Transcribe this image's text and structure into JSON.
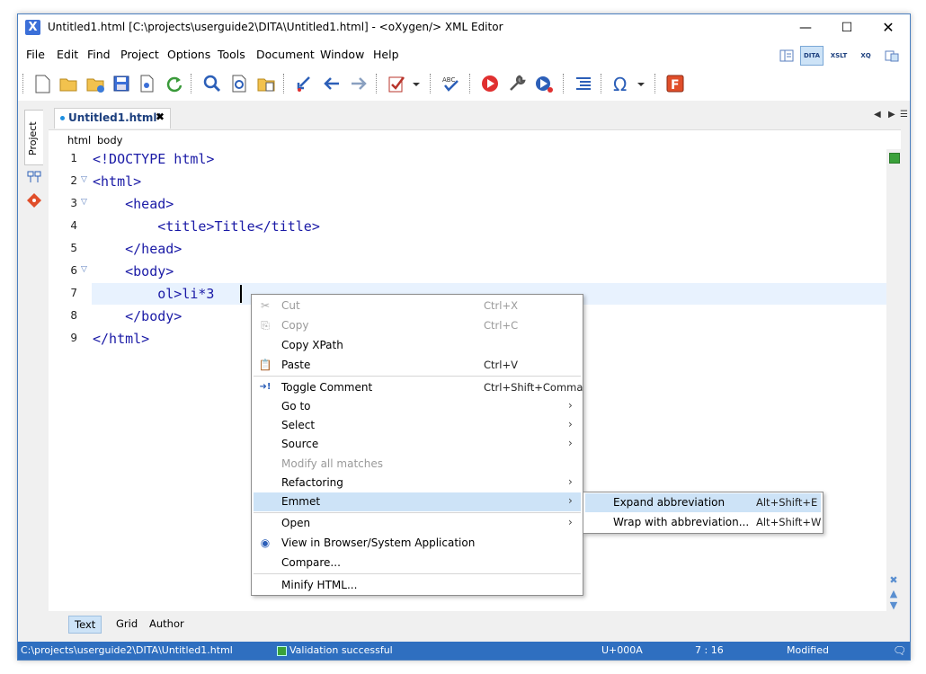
{
  "window": {
    "title": "Untitled1.html [C:\\projects\\userguide2\\DITA\\Untitled1.html] - <oXygen/> XML Editor",
    "minimize": "—",
    "maximize": "☐",
    "close": "✕"
  },
  "menubar": [
    "File",
    "Edit",
    "Find",
    "Project",
    "Options",
    "Tools",
    "Document",
    "Window",
    "Help"
  ],
  "perspectives": [
    "",
    "DITA",
    "XSLT",
    "XQ",
    ""
  ],
  "sidebar": {
    "project_tab": "Project"
  },
  "tab": {
    "name": "Untitled1.html*",
    "close": "✖"
  },
  "breadcrumb": [
    "html",
    "body"
  ],
  "code": {
    "lines": [
      {
        "no": "1",
        "text": "<!DOCTYPE html>"
      },
      {
        "no": "2",
        "text": "<html>"
      },
      {
        "no": "3",
        "text": "    <head>"
      },
      {
        "no": "4",
        "text": "        <title>Title</title>"
      },
      {
        "no": "5",
        "text": "    </head>"
      },
      {
        "no": "6",
        "text": "    <body>"
      },
      {
        "no": "7",
        "text": "        ol>li*3"
      },
      {
        "no": "8",
        "text": "    </body>"
      },
      {
        "no": "9",
        "text": "</html>"
      }
    ]
  },
  "bottom_tabs": [
    "Text",
    "Grid",
    "Author"
  ],
  "status": {
    "path": "C:\\projects\\userguide2\\DITA\\Untitled1.html",
    "validation": "Validation successful",
    "unicode": "U+000A",
    "position": "7 : 16",
    "state": "Modified"
  },
  "context_menu": {
    "items": [
      {
        "label": "Cut",
        "shortcut": "Ctrl+X",
        "icon": "✂",
        "disabled": true
      },
      {
        "label": "Copy",
        "shortcut": "Ctrl+C",
        "icon": "⎘",
        "disabled": true
      },
      {
        "label": "Copy XPath",
        "shortcut": "",
        "icon": ""
      },
      {
        "label": "Paste",
        "shortcut": "Ctrl+V",
        "icon": "📋"
      },
      {
        "label": "Toggle Comment",
        "shortcut": "Ctrl+Shift+Comma",
        "icon": "➜!"
      },
      {
        "label": "Go to",
        "arrow": "›"
      },
      {
        "label": "Select",
        "arrow": "›"
      },
      {
        "label": "Source",
        "arrow": "›"
      },
      {
        "label": "Modify all matches",
        "disabled": true
      },
      {
        "label": "Refactoring",
        "arrow": "›"
      },
      {
        "label": "Emmet",
        "arrow": "›"
      },
      {
        "label": "Open",
        "arrow": "›"
      },
      {
        "label": "View in Browser/System Application",
        "icon": "◉"
      },
      {
        "label": "Compare..."
      },
      {
        "label": "Minify HTML..."
      }
    ]
  },
  "submenu": {
    "items": [
      {
        "label": "Expand abbreviation",
        "shortcut": "Alt+Shift+E"
      },
      {
        "label": "Wrap with abbreviation...",
        "shortcut": "Alt+Shift+W"
      }
    ]
  },
  "colors": {
    "accent": "#2f6fc0",
    "highlight": "#cde3f7",
    "code": "#1a1aa6"
  }
}
